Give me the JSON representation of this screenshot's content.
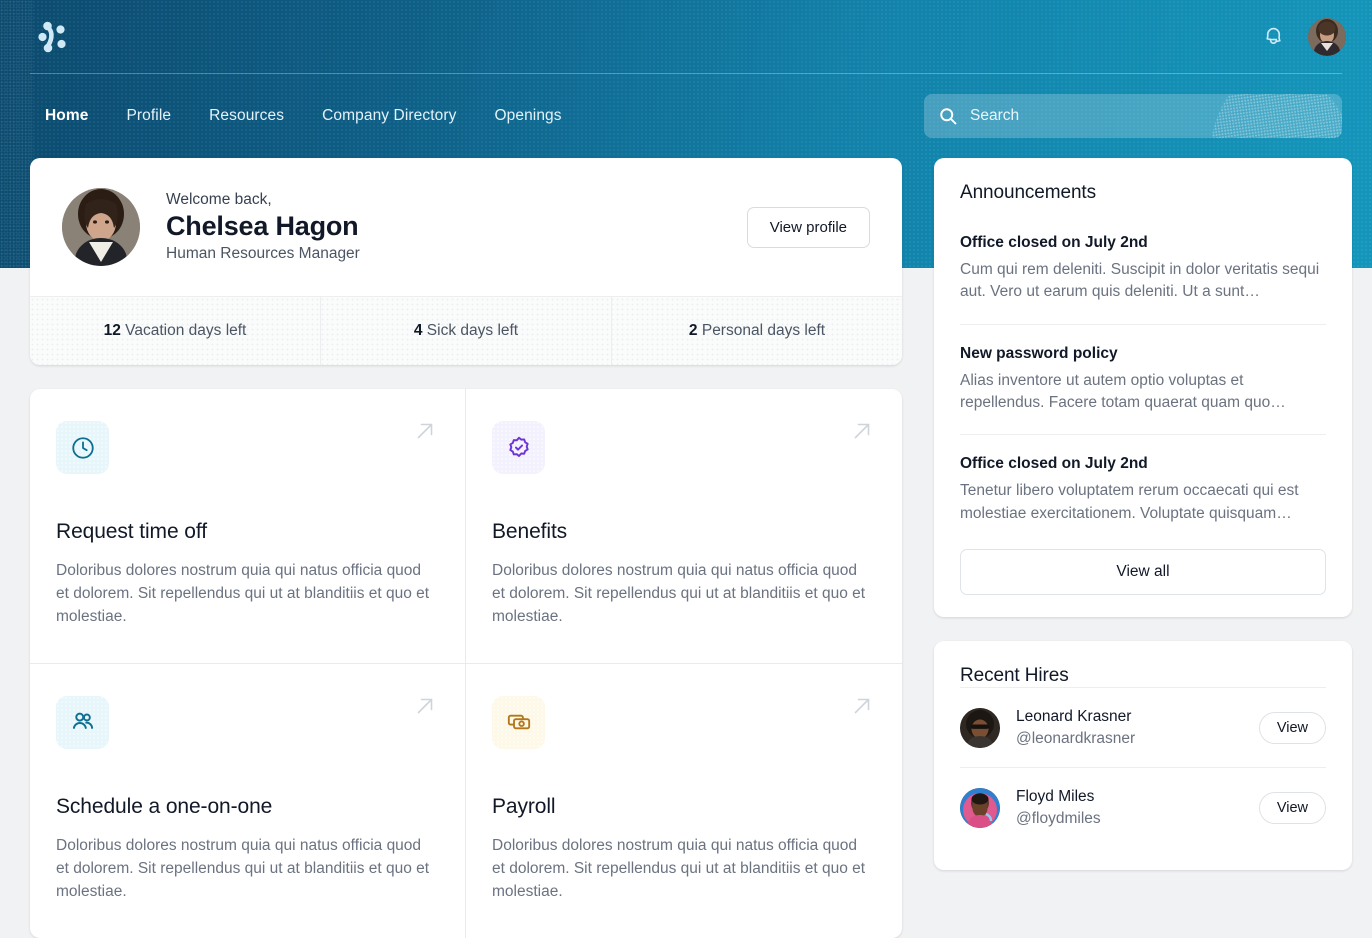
{
  "header": {
    "logo_icon": "molecule-logo-icon",
    "notification_icon": "bell-icon",
    "avatar_icon": "user-avatar",
    "nav": [
      {
        "label": "Home",
        "active": true
      },
      {
        "label": "Profile",
        "active": false
      },
      {
        "label": "Resources",
        "active": false
      },
      {
        "label": "Company Directory",
        "active": false
      },
      {
        "label": "Openings",
        "active": false
      }
    ],
    "search": {
      "icon": "search-icon",
      "placeholder": "Search",
      "value": ""
    }
  },
  "welcome": {
    "greeting": "Welcome back,",
    "name": "Chelsea Hagon",
    "role": "Human Resources Manager",
    "button": "View profile",
    "stats": [
      {
        "value": "12",
        "label": " Vacation days left"
      },
      {
        "value": "4",
        "label": " Sick days left"
      },
      {
        "value": "2",
        "label": " Personal days left"
      }
    ]
  },
  "actions": [
    {
      "title": "Request time off",
      "desc": "Doloribus dolores nostrum quia qui natus officia quod et dolorem. Sit repellendus qui ut at blanditiis et quo et molestiae.",
      "icon": "clock-icon",
      "tone": "teal"
    },
    {
      "title": "Benefits",
      "desc": "Doloribus dolores nostrum quia qui natus officia quod et dolorem. Sit repellendus qui ut at blanditiis et quo et molestiae.",
      "icon": "badge-check-icon",
      "tone": "purple"
    },
    {
      "title": "Schedule a one-on-one",
      "desc": "Doloribus dolores nostrum quia qui natus officia quod et dolorem. Sit repellendus qui ut at blanditiis et quo et molestiae.",
      "icon": "users-icon",
      "tone": "teal"
    },
    {
      "title": "Payroll",
      "desc": "Doloribus dolores nostrum quia qui natus officia quod et dolorem. Sit repellendus qui ut at blanditiis et quo et molestiae.",
      "icon": "banknotes-icon",
      "tone": "amber"
    }
  ],
  "announcements": {
    "title": "Announcements",
    "items": [
      {
        "title": "Office closed on July 2nd",
        "body": "Cum qui rem deleniti. Suscipit in dolor veritatis sequi aut. Vero ut earum quis deleniti. Ut a sunt…"
      },
      {
        "title": "New password policy",
        "body": "Alias inventore ut autem optio voluptas et repellendus. Facere totam quaerat quam quo…"
      },
      {
        "title": "Office closed on July 2nd",
        "body": "Tenetur libero voluptatem rerum occaecati qui est molestiae exercitationem. Voluptate quisquam…"
      }
    ],
    "view_all": "View all"
  },
  "recent_hires": {
    "title": "Recent Hires",
    "items": [
      {
        "name": "Leonard Krasner",
        "handle": "@leonardkrasner",
        "button": "View"
      },
      {
        "name": "Floyd Miles",
        "handle": "@floydmiles",
        "button": "View"
      }
    ]
  },
  "colors": {
    "brand_dark": "#0c4a6e",
    "brand_light": "#1496bb",
    "page_bg": "#f1f2f4",
    "accent_teal": "#0f6f91",
    "accent_purple": "#6d35d6",
    "accent_amber": "#b3761a"
  }
}
